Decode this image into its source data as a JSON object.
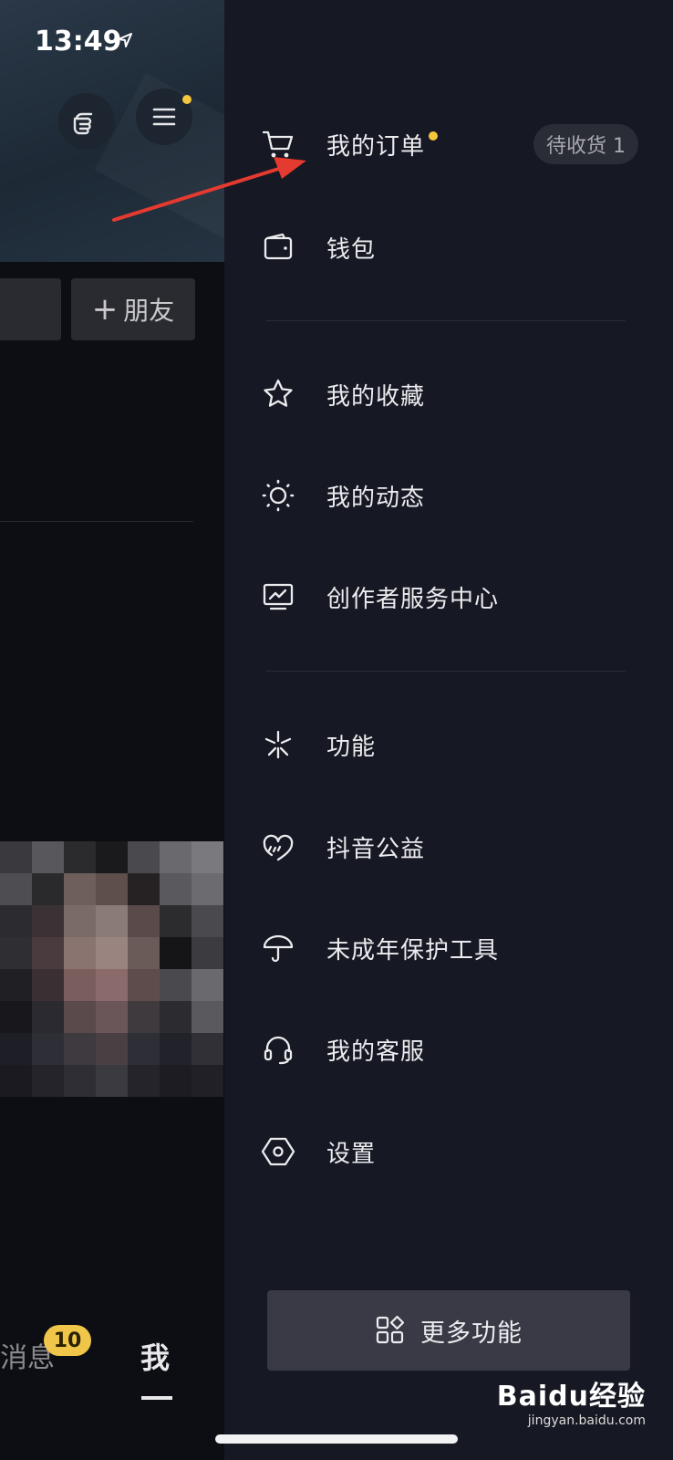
{
  "status_bar": {
    "time": "13:49"
  },
  "background_page": {
    "add_friend_label": "朋友",
    "add_friend_plus": "+",
    "tabs": {
      "messages_label": "消息",
      "messages_badge": "10",
      "me_label": "我"
    }
  },
  "drawer": {
    "items": [
      {
        "label": "我的订单",
        "icon": "cart-icon",
        "status": "待收货 1"
      },
      {
        "label": "钱包",
        "icon": "wallet-icon"
      },
      {
        "label": "我的收藏",
        "icon": "star-icon"
      },
      {
        "label": "我的动态",
        "icon": "sun-icon"
      },
      {
        "label": "创作者服务中心",
        "icon": "monitor-chart-icon"
      },
      {
        "label": "功能",
        "icon": "sparkle-icon"
      },
      {
        "label": "抖音公益",
        "icon": "heart-rain-icon"
      },
      {
        "label": "未成年保护工具",
        "icon": "umbrella-icon"
      },
      {
        "label": "我的客服",
        "icon": "headset-icon"
      },
      {
        "label": "设置",
        "icon": "hexagon-gear-icon"
      }
    ],
    "more_button_label": "更多功能"
  },
  "watermark": {
    "main": "Baidu经验",
    "sub": "jingyan.baidu.com"
  },
  "colors": {
    "drawer_bg": "#161823",
    "accent_dot": "#f4c73c",
    "annotation_arrow": "#e53a2f",
    "badge_bg": "#f0c64a"
  }
}
